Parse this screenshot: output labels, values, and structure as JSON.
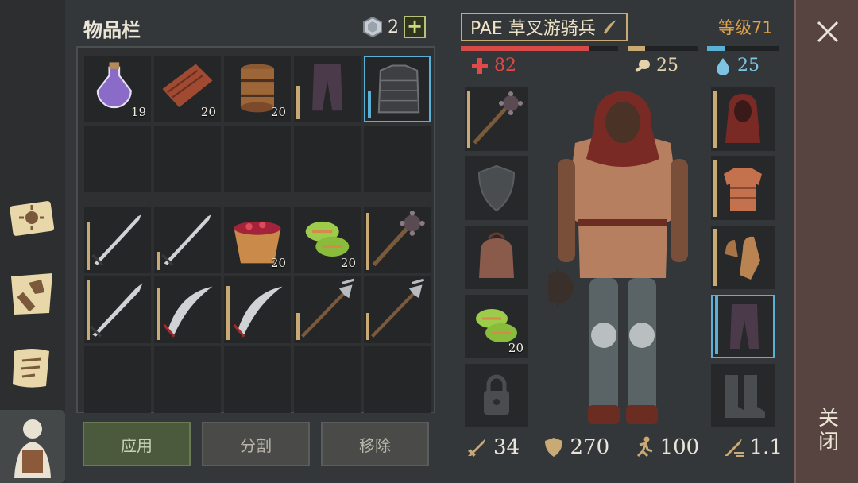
{
  "inventory": {
    "title": "物品栏",
    "currency_value": "2",
    "plus_label": "+",
    "rows": [
      [
        {
          "icon": "potion-icon",
          "count": "19"
        },
        {
          "icon": "leather-icon",
          "count": "20"
        },
        {
          "icon": "barrel-icon",
          "count": "20"
        },
        {
          "icon": "pants-icon",
          "count": "",
          "durability": 0.55
        },
        {
          "icon": "chainmail-icon",
          "count": "",
          "durability": 0.45,
          "highlight": true
        }
      ],
      [
        {},
        {},
        {},
        {},
        {}
      ],
      [
        {
          "icon": "sword-icon",
          "count": "",
          "durability": 0.8
        },
        {
          "icon": "sword-icon",
          "count": "",
          "durability": 0.3
        },
        {
          "icon": "berry-bucket-icon",
          "count": "20"
        },
        {
          "icon": "bandage-icon",
          "count": "20"
        },
        {
          "icon": "mace-icon",
          "count": "",
          "durability": 0.95
        }
      ],
      [
        {
          "icon": "long-sword-icon",
          "count": "",
          "durability": 1.0
        },
        {
          "icon": "scimitar-icon",
          "count": "",
          "durability": 0.85
        },
        {
          "icon": "scimitar-icon",
          "count": "",
          "durability": 0.9
        },
        {
          "icon": "halberd-icon",
          "count": "",
          "durability": 0.45
        },
        {
          "icon": "halberd-icon",
          "count": "",
          "durability": 0.45
        }
      ],
      [
        {},
        {},
        {},
        {},
        {}
      ]
    ]
  },
  "buttons": {
    "apply": "应用",
    "split": "分割",
    "remove": "移除"
  },
  "character": {
    "name": "PAE 草叉游骑兵",
    "level": "等级71",
    "health": "82",
    "food": "25",
    "water": "25",
    "health_fill": 0.82,
    "food_fill": 0.25,
    "water_fill": 0.25,
    "left_slots": [
      {
        "icon": "mace-icon",
        "count": "",
        "durability": 0.95
      },
      {
        "icon": "shield-icon",
        "count": ""
      },
      {
        "icon": "bag-icon",
        "count": ""
      },
      {
        "icon": "bandage-icon",
        "count": "20"
      },
      {
        "icon": "lock-icon",
        "count": ""
      }
    ],
    "right_slots": [
      {
        "icon": "hood-icon",
        "count": "",
        "durability": 0.95
      },
      {
        "icon": "tunic-icon",
        "count": "",
        "durability": 0.95
      },
      {
        "icon": "gloves-icon",
        "count": "",
        "durability": 0.95
      },
      {
        "icon": "pants-icon",
        "count": "",
        "durability": 0.95,
        "highlight": true
      },
      {
        "icon": "boots-icon",
        "count": ""
      }
    ],
    "attack": "34",
    "armor": "270",
    "speed": "100",
    "attack_speed": "1.1"
  },
  "close": {
    "label": "关闭"
  },
  "colors": {
    "health": "#d84a48",
    "food": "#c9a974",
    "water": "#5bb0d6",
    "level": "#e0a348"
  }
}
